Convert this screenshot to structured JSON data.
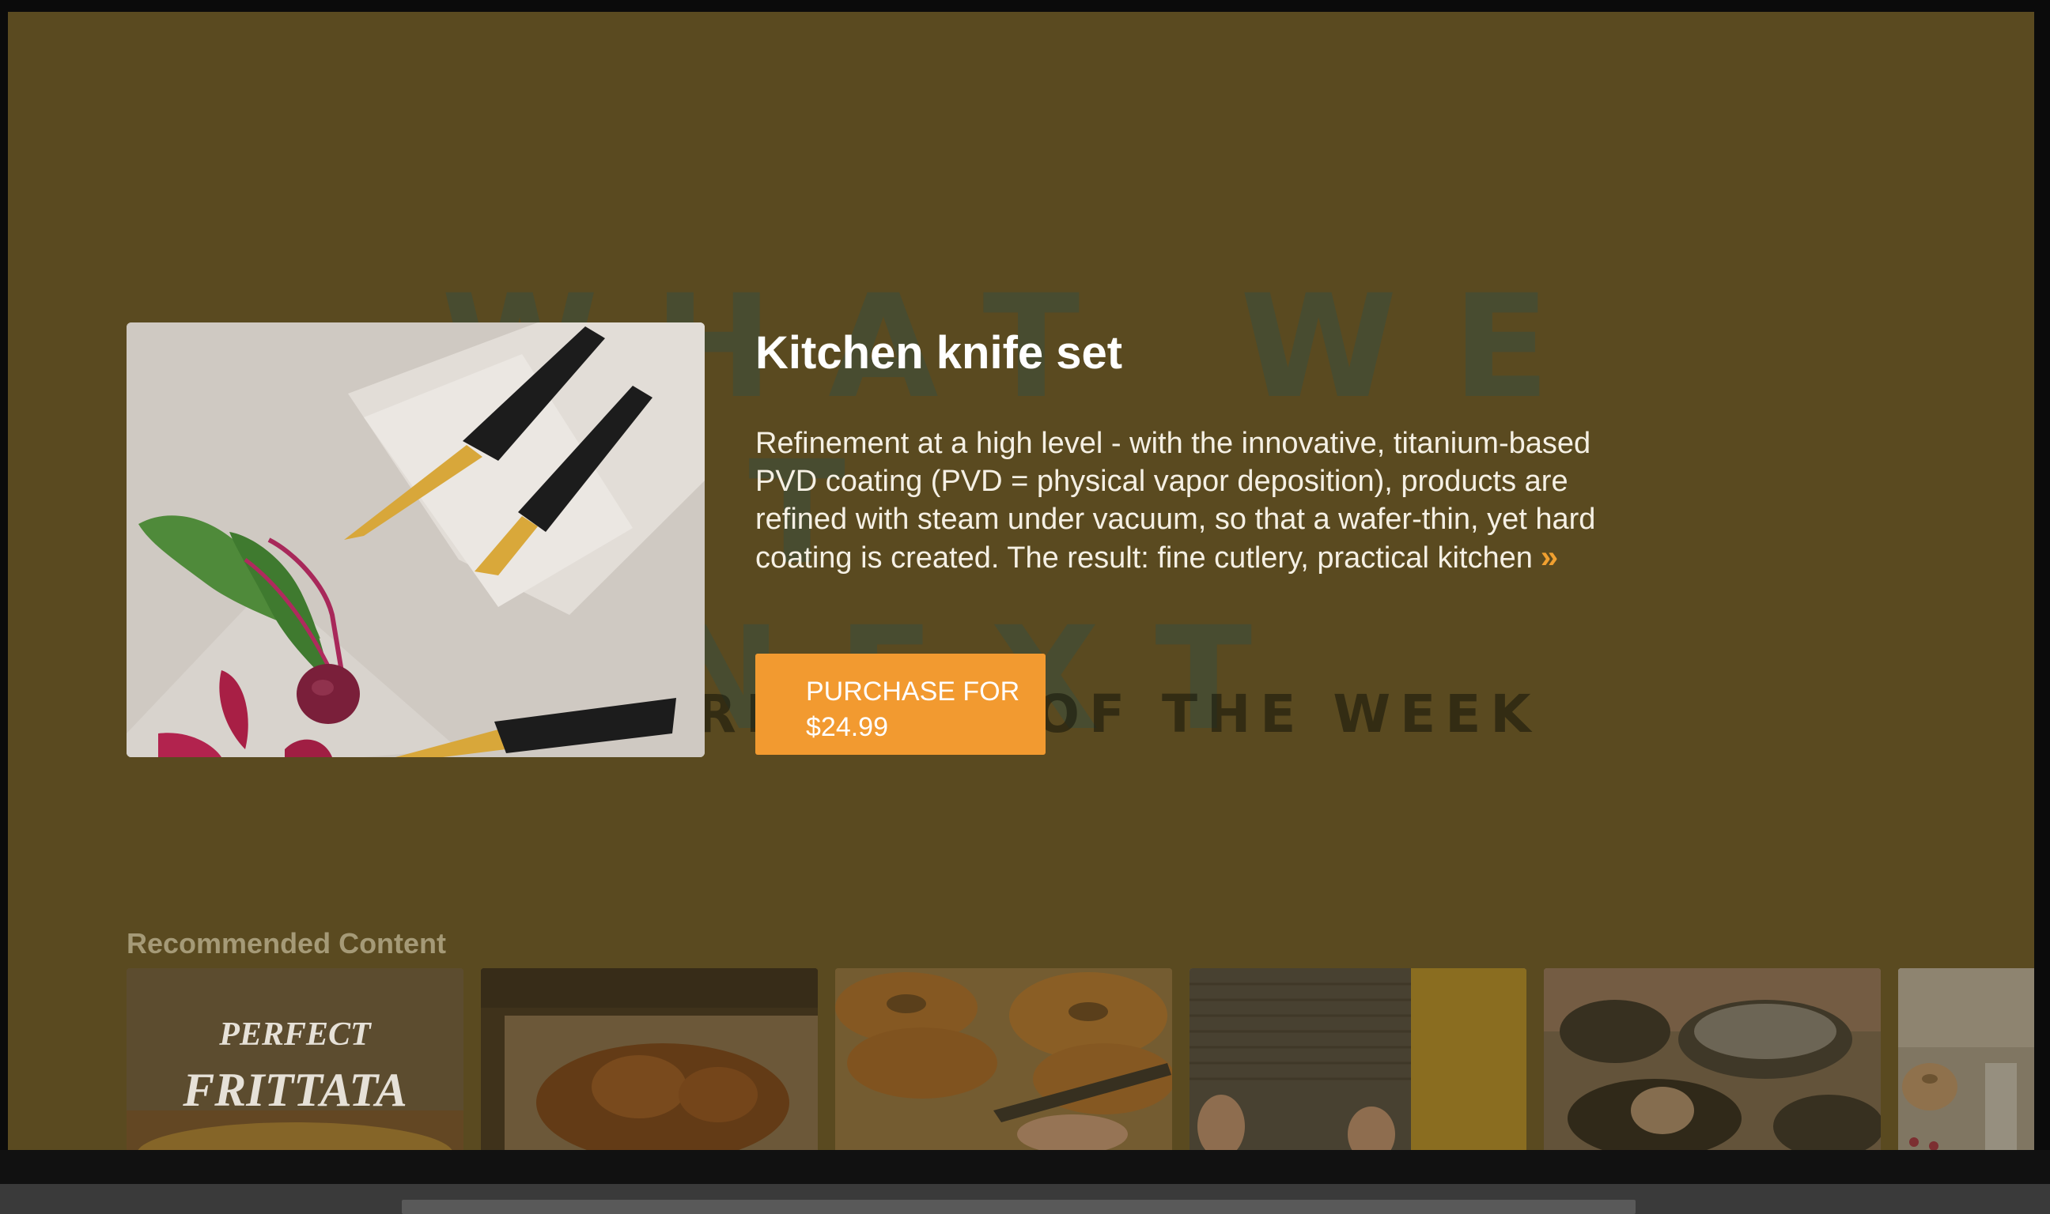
{
  "background": {
    "title_line1": "WHAT WE EAT",
    "title_line2": "NEXT",
    "subtitle": "RECIPES OF THE WEEK"
  },
  "product": {
    "title": "Kitchen knife set",
    "description": "Refinement at a high level - with the innovative, titanium-based PVD coating (PVD = physical vapor deposition), products are refined with steam under vacuum, so that a wafer-thin, yet hard coating is created. The result: fine cutlery, practical kitchen",
    "more_icon": "double-chevron-right-icon",
    "purchase_line1": "PURCHASE FOR",
    "purchase_line2": "$24.99",
    "accent_color": "#f29a30"
  },
  "recommended": {
    "heading": "Recommended Content",
    "items": [
      {
        "name": "frittata",
        "text_line1": "PERFECT",
        "text_line2": "FRITTATA"
      },
      {
        "name": "bread"
      },
      {
        "name": "bagels"
      },
      {
        "name": "couple"
      },
      {
        "name": "cookware"
      },
      {
        "name": "bundt-cake"
      }
    ]
  },
  "colors": {
    "overlay": "#5a4a20",
    "heading": "#a59a77"
  }
}
